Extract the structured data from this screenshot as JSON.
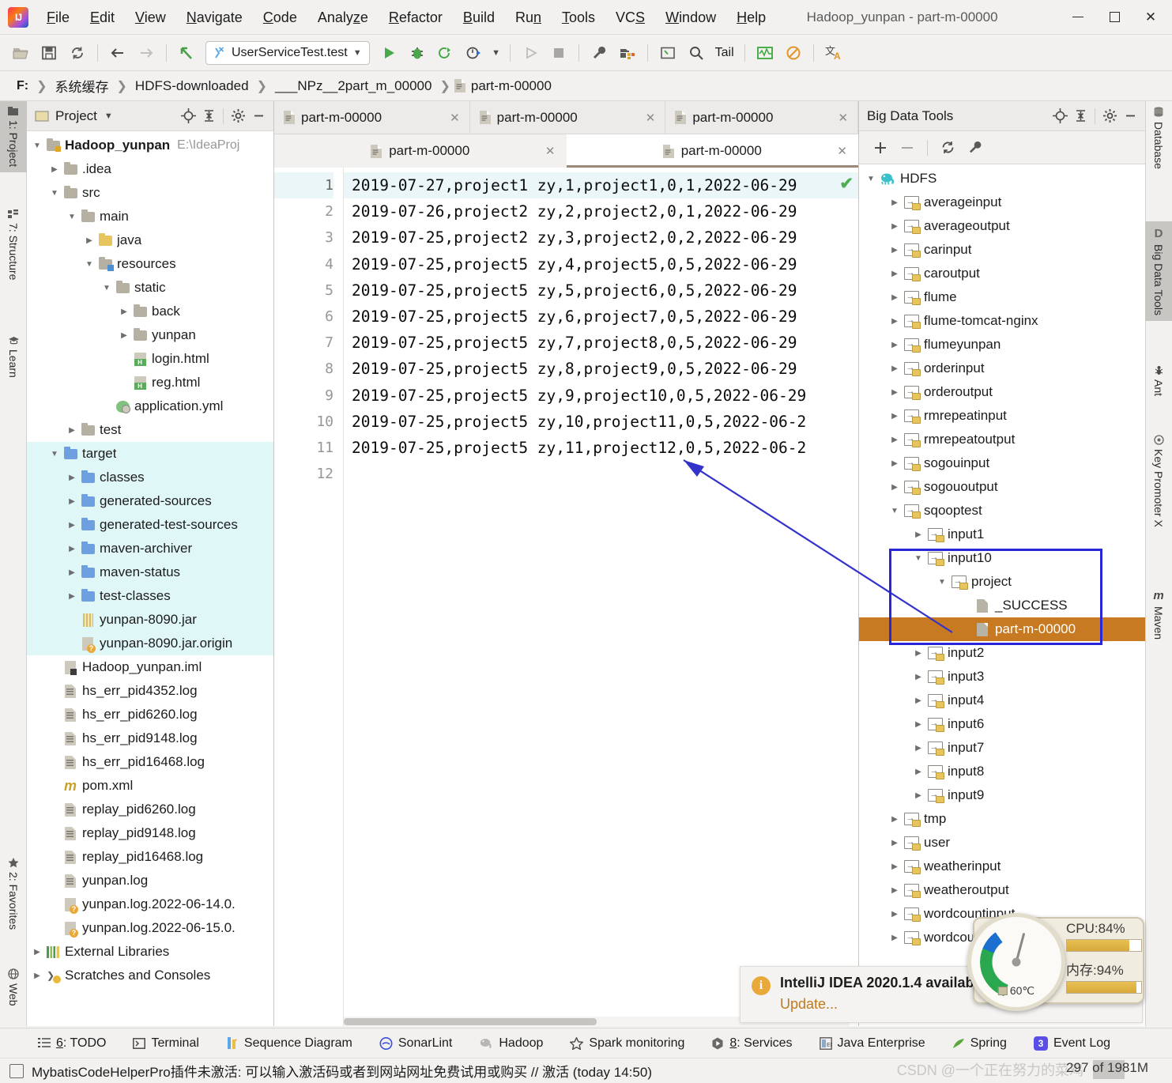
{
  "window": {
    "title": "Hadoop_yunpan - part-m-00000",
    "minimize": "–",
    "maximize": "□",
    "close": "✕"
  },
  "menu": [
    {
      "label": "File",
      "mnemonic": "F"
    },
    {
      "label": "Edit",
      "mnemonic": "E"
    },
    {
      "label": "View",
      "mnemonic": "V"
    },
    {
      "label": "Navigate",
      "mnemonic": "N"
    },
    {
      "label": "Code",
      "mnemonic": "C"
    },
    {
      "label": "Analyze",
      "mnemonic": "z"
    },
    {
      "label": "Refactor",
      "mnemonic": "R"
    },
    {
      "label": "Build",
      "mnemonic": "B"
    },
    {
      "label": "Run",
      "mnemonic": "n"
    },
    {
      "label": "Tools",
      "mnemonic": "T"
    },
    {
      "label": "VCS",
      "mnemonic": "S"
    },
    {
      "label": "Window",
      "mnemonic": "W"
    },
    {
      "label": "Help",
      "mnemonic": "H"
    }
  ],
  "toolbar": {
    "open_icon": "open-folder-icon",
    "save_icon": "save-icon",
    "sync_icon": "sync-icon",
    "back_icon": "back-arrow-icon",
    "forward_icon": "forward-arrow-icon",
    "undo_icon": "undo-icon",
    "run_config": "UserServiceTest.test",
    "run_icon": "run-icon",
    "debug_icon": "debug-icon",
    "run_coverage_icon": "run-with-coverage-icon",
    "profile_icon": "profile-icon",
    "stop_icon": "stop-icon",
    "settings_icon": "wrench-icon",
    "project_structure_icon": "project-structure-icon",
    "terminal_icon": "terminal-icon",
    "search_icon": "search-icon",
    "tail_label": "Tail",
    "monitor_icon": "monitor-icon",
    "block_icon": "block-icon",
    "translate_icon": "translate-icon"
  },
  "breadcrumb": {
    "drive": "F:",
    "items": [
      "系统缓存",
      "HDFS-downloaded",
      "___NPz__2part_m_00000",
      "part-m-00000"
    ]
  },
  "left_strip": [
    {
      "label": "1: Project",
      "icon": "project-icon",
      "active": true
    },
    {
      "label": "7: Structure",
      "icon": "structure-icon",
      "active": false
    },
    {
      "label": "Learn",
      "icon": "graduation-cap-icon",
      "active": false
    },
    {
      "label": "2: Favorites",
      "icon": "star-icon",
      "active": false
    },
    {
      "label": "Web",
      "icon": "globe-icon",
      "active": false
    }
  ],
  "right_strip": [
    {
      "label": "Database",
      "icon": "database-icon",
      "active": false
    },
    {
      "label": "Big Data Tools",
      "icon": "bigdata-icon",
      "active": true
    },
    {
      "label": "Ant",
      "icon": "ant-icon",
      "active": false
    },
    {
      "label": "Key Promoter X",
      "icon": "key-promoter-icon",
      "active": false
    },
    {
      "label": "Maven",
      "icon": "maven-icon",
      "active": false
    }
  ],
  "project_panel": {
    "title": "Project",
    "dropdown_icon": "chevron-down-icon",
    "locate_icon": "locate-target-icon",
    "collapse_icon": "collapse-all-icon",
    "settings_icon": "gear-icon",
    "hide_icon": "hide-icon",
    "tree": [
      {
        "label": "Hadoop_yunpan",
        "path": "E:\\IdeaProj",
        "indent": 0,
        "arrow": "down",
        "icon": "module-folder",
        "bold": true,
        "hl": false
      },
      {
        "label": ".idea",
        "indent": 1,
        "arrow": "right",
        "icon": "folder",
        "hl": false
      },
      {
        "label": "src",
        "indent": 1,
        "arrow": "down",
        "icon": "folder",
        "hl": false
      },
      {
        "label": "main",
        "indent": 2,
        "arrow": "down",
        "icon": "folder",
        "hl": false
      },
      {
        "label": "java",
        "indent": 3,
        "arrow": "right",
        "icon": "folder-yellow",
        "hl": false
      },
      {
        "label": "resources",
        "indent": 3,
        "arrow": "down",
        "icon": "folder-resources",
        "hl": false
      },
      {
        "label": "static",
        "indent": 4,
        "arrow": "down",
        "icon": "folder",
        "hl": false
      },
      {
        "label": "back",
        "indent": 5,
        "arrow": "right",
        "icon": "folder",
        "hl": false
      },
      {
        "label": "yunpan",
        "indent": 5,
        "arrow": "right",
        "icon": "folder",
        "hl": false
      },
      {
        "label": "login.html",
        "indent": 5,
        "arrow": "none",
        "icon": "html-file",
        "hl": false
      },
      {
        "label": "reg.html",
        "indent": 5,
        "arrow": "none",
        "icon": "html-file",
        "hl": false
      },
      {
        "label": "application.yml",
        "indent": 4,
        "arrow": "none",
        "icon": "yml-file",
        "hl": false
      },
      {
        "label": "test",
        "indent": 2,
        "arrow": "right",
        "icon": "folder",
        "hl": false
      },
      {
        "label": "target",
        "indent": 1,
        "arrow": "down",
        "icon": "folder-blue",
        "hl": true
      },
      {
        "label": "classes",
        "indent": 2,
        "arrow": "right",
        "icon": "folder-blue",
        "hl": true
      },
      {
        "label": "generated-sources",
        "indent": 2,
        "arrow": "right",
        "icon": "folder-blue",
        "hl": true
      },
      {
        "label": "generated-test-sources",
        "indent": 2,
        "arrow": "right",
        "icon": "folder-blue",
        "hl": true
      },
      {
        "label": "maven-archiver",
        "indent": 2,
        "arrow": "right",
        "icon": "folder-blue",
        "hl": true
      },
      {
        "label": "maven-status",
        "indent": 2,
        "arrow": "right",
        "icon": "folder-blue",
        "hl": true
      },
      {
        "label": "test-classes",
        "indent": 2,
        "arrow": "right",
        "icon": "folder-blue",
        "hl": true
      },
      {
        "label": "yunpan-8090.jar",
        "indent": 2,
        "arrow": "none",
        "icon": "jar-file",
        "hl": true
      },
      {
        "label": "yunpan-8090.jar.origin",
        "indent": 2,
        "arrow": "none",
        "icon": "unknown-file",
        "hl": true
      },
      {
        "label": "Hadoop_yunpan.iml",
        "indent": 1,
        "arrow": "none",
        "icon": "iml-file",
        "hl": false
      },
      {
        "label": "hs_err_pid4352.log",
        "indent": 1,
        "arrow": "none",
        "icon": "log-file",
        "hl": false
      },
      {
        "label": "hs_err_pid6260.log",
        "indent": 1,
        "arrow": "none",
        "icon": "log-file",
        "hl": false
      },
      {
        "label": "hs_err_pid9148.log",
        "indent": 1,
        "arrow": "none",
        "icon": "log-file",
        "hl": false
      },
      {
        "label": "hs_err_pid16468.log",
        "indent": 1,
        "arrow": "none",
        "icon": "log-file",
        "hl": false
      },
      {
        "label": "pom.xml",
        "indent": 1,
        "arrow": "none",
        "icon": "maven-file",
        "hl": false
      },
      {
        "label": "replay_pid6260.log",
        "indent": 1,
        "arrow": "none",
        "icon": "log-file",
        "hl": false
      },
      {
        "label": "replay_pid9148.log",
        "indent": 1,
        "arrow": "none",
        "icon": "log-file",
        "hl": false
      },
      {
        "label": "replay_pid16468.log",
        "indent": 1,
        "arrow": "none",
        "icon": "log-file",
        "hl": false
      },
      {
        "label": "yunpan.log",
        "indent": 1,
        "arrow": "none",
        "icon": "log-file",
        "hl": false
      },
      {
        "label": "yunpan.log.2022-06-14.0.",
        "indent": 1,
        "arrow": "none",
        "icon": "unknown-file",
        "hl": false
      },
      {
        "label": "yunpan.log.2022-06-15.0.",
        "indent": 1,
        "arrow": "none",
        "icon": "unknown-file",
        "hl": false
      },
      {
        "label": "External Libraries",
        "indent": 0,
        "arrow": "right",
        "icon": "libraries",
        "hl": false
      },
      {
        "label": "Scratches and Consoles",
        "indent": 0,
        "arrow": "right",
        "icon": "scratches",
        "hl": false
      }
    ]
  },
  "editor": {
    "tabs_row1": [
      {
        "label": "part-m-00000",
        "icon": "file-icon",
        "close": "✕"
      },
      {
        "label": "part-m-00000",
        "icon": "file-icon",
        "close": "✕"
      },
      {
        "label": "part-m-00000",
        "icon": "file-icon",
        "close": "✕"
      }
    ],
    "tabs_row2": [
      {
        "label": "part-m-00000",
        "icon": "file-icon",
        "close": "✕",
        "selected": false
      },
      {
        "label": "part-m-00000",
        "icon": "file-icon",
        "close": "✕",
        "selected": true
      }
    ],
    "inspection_mark": "✔",
    "lines": [
      {
        "n": "1",
        "text": "2019-07-27,project1 zy,1,project1,0,1,2022-06-29"
      },
      {
        "n": "2",
        "text": "2019-07-26,project2 zy,2,project2,0,1,2022-06-29"
      },
      {
        "n": "3",
        "text": "2019-07-25,project2 zy,3,project2,0,2,2022-06-29"
      },
      {
        "n": "4",
        "text": "2019-07-25,project5 zy,4,project5,0,5,2022-06-29"
      },
      {
        "n": "5",
        "text": "2019-07-25,project5 zy,5,project6,0,5,2022-06-29"
      },
      {
        "n": "6",
        "text": "2019-07-25,project5 zy,6,project7,0,5,2022-06-29"
      },
      {
        "n": "7",
        "text": "2019-07-25,project5 zy,7,project8,0,5,2022-06-29"
      },
      {
        "n": "8",
        "text": "2019-07-25,project5 zy,8,project9,0,5,2022-06-29"
      },
      {
        "n": "9",
        "text": "2019-07-25,project5 zy,9,project10,0,5,2022-06-29"
      },
      {
        "n": "10",
        "text": "2019-07-25,project5 zy,10,project11,0,5,2022-06-2"
      },
      {
        "n": "11",
        "text": "2019-07-25,project5 zy,11,project12,0,5,2022-06-2"
      },
      {
        "n": "12",
        "text": ""
      }
    ]
  },
  "bigdata": {
    "title": "Big Data Tools",
    "locate_icon": "locate-target-icon",
    "collapse_icon": "collapse-all-icon",
    "settings_icon": "gear-icon",
    "hide_icon": "hide-icon",
    "add_icon": "plus-icon",
    "remove_icon": "minus-icon",
    "refresh_icon": "refresh-icon",
    "config_icon": "wrench-icon",
    "tree": [
      {
        "label": "HDFS",
        "indent": 0,
        "arrow": "down",
        "icon": "elephant",
        "sel": false
      },
      {
        "label": "averageinput",
        "indent": 1,
        "arrow": "right",
        "icon": "hdfs-folder",
        "sel": false
      },
      {
        "label": "averageoutput",
        "indent": 1,
        "arrow": "right",
        "icon": "hdfs-folder",
        "sel": false
      },
      {
        "label": "carinput",
        "indent": 1,
        "arrow": "right",
        "icon": "hdfs-folder",
        "sel": false
      },
      {
        "label": "caroutput",
        "indent": 1,
        "arrow": "right",
        "icon": "hdfs-folder",
        "sel": false
      },
      {
        "label": "flume",
        "indent": 1,
        "arrow": "right",
        "icon": "hdfs-folder",
        "sel": false
      },
      {
        "label": "flume-tomcat-nginx",
        "indent": 1,
        "arrow": "right",
        "icon": "hdfs-folder",
        "sel": false
      },
      {
        "label": "flumeyunpan",
        "indent": 1,
        "arrow": "right",
        "icon": "hdfs-folder",
        "sel": false
      },
      {
        "label": "orderinput",
        "indent": 1,
        "arrow": "right",
        "icon": "hdfs-folder",
        "sel": false
      },
      {
        "label": "orderoutput",
        "indent": 1,
        "arrow": "right",
        "icon": "hdfs-folder",
        "sel": false
      },
      {
        "label": "rmrepeatinput",
        "indent": 1,
        "arrow": "right",
        "icon": "hdfs-folder",
        "sel": false
      },
      {
        "label": "rmrepeatoutput",
        "indent": 1,
        "arrow": "right",
        "icon": "hdfs-folder",
        "sel": false
      },
      {
        "label": "sogouinput",
        "indent": 1,
        "arrow": "right",
        "icon": "hdfs-folder",
        "sel": false
      },
      {
        "label": "sogououtput",
        "indent": 1,
        "arrow": "right",
        "icon": "hdfs-folder",
        "sel": false
      },
      {
        "label": "sqooptest",
        "indent": 1,
        "arrow": "down",
        "icon": "hdfs-folder",
        "sel": false
      },
      {
        "label": "input1",
        "indent": 2,
        "arrow": "right",
        "icon": "hdfs-folder",
        "sel": false
      },
      {
        "label": "input10",
        "indent": 2,
        "arrow": "down",
        "icon": "hdfs-folder",
        "sel": false
      },
      {
        "label": "project",
        "indent": 3,
        "arrow": "down",
        "icon": "hdfs-folder",
        "sel": false
      },
      {
        "label": "_SUCCESS",
        "indent": 4,
        "arrow": "none",
        "icon": "hdfs-file",
        "sel": false
      },
      {
        "label": "part-m-00000",
        "indent": 4,
        "arrow": "none",
        "icon": "hdfs-file",
        "sel": true
      },
      {
        "label": "input2",
        "indent": 2,
        "arrow": "right",
        "icon": "hdfs-folder",
        "sel": false
      },
      {
        "label": "input3",
        "indent": 2,
        "arrow": "right",
        "icon": "hdfs-folder",
        "sel": false
      },
      {
        "label": "input4",
        "indent": 2,
        "arrow": "right",
        "icon": "hdfs-folder",
        "sel": false
      },
      {
        "label": "input6",
        "indent": 2,
        "arrow": "right",
        "icon": "hdfs-folder",
        "sel": false
      },
      {
        "label": "input7",
        "indent": 2,
        "arrow": "right",
        "icon": "hdfs-folder",
        "sel": false
      },
      {
        "label": "input8",
        "indent": 2,
        "arrow": "right",
        "icon": "hdfs-folder",
        "sel": false
      },
      {
        "label": "input9",
        "indent": 2,
        "arrow": "right",
        "icon": "hdfs-folder",
        "sel": false
      },
      {
        "label": "tmp",
        "indent": 1,
        "arrow": "right",
        "icon": "hdfs-folder",
        "sel": false
      },
      {
        "label": "user",
        "indent": 1,
        "arrow": "right",
        "icon": "hdfs-folder",
        "sel": false
      },
      {
        "label": "weatherinput",
        "indent": 1,
        "arrow": "right",
        "icon": "hdfs-folder",
        "sel": false
      },
      {
        "label": "weatheroutput",
        "indent": 1,
        "arrow": "right",
        "icon": "hdfs-folder",
        "sel": false
      },
      {
        "label": "wordcountinput",
        "indent": 1,
        "arrow": "right",
        "icon": "hdfs-folder",
        "sel": false
      },
      {
        "label": "wordcountoutput",
        "indent": 1,
        "arrow": "right",
        "icon": "hdfs-folder",
        "sel": false
      }
    ]
  },
  "annotation": {
    "highlight_color": "#2727d8",
    "selection_color": "#c87a23",
    "arrow_color": "#3333cc"
  },
  "cpu_widget": {
    "cpu_label": "CPU:84%",
    "cpu_percent": 84,
    "mem_label": "内存:94%",
    "mem_percent": 94,
    "temperature": "60℃"
  },
  "notification": {
    "icon": "info-icon",
    "title": "IntelliJ IDEA 2020.1.4 available",
    "action": "Update..."
  },
  "bottom_bar": [
    {
      "label": "6: TODO",
      "icon": "todo-icon",
      "mnemonic": "6"
    },
    {
      "label": "Terminal",
      "icon": "terminal-icon"
    },
    {
      "label": "Sequence Diagram",
      "icon": "sequence-diagram-icon"
    },
    {
      "label": "SonarLint",
      "icon": "sonarlint-icon"
    },
    {
      "label": "Hadoop",
      "icon": "hadoop-elephant-icon"
    },
    {
      "label": "Spark monitoring",
      "icon": "star-icon"
    },
    {
      "label": "8: Services",
      "icon": "services-icon",
      "mnemonic": "8"
    },
    {
      "label": "Java Enterprise",
      "icon": "java-enterprise-icon"
    },
    {
      "label": "Spring",
      "icon": "spring-leaf-icon"
    },
    {
      "label": "Event Log",
      "icon": "event-log-icon",
      "badge": "3"
    }
  ],
  "status_bar": {
    "icon": "plugin-icon",
    "message": "MybatisCodeHelperPro插件未激活: 可以输入激活码或者到网站网址免费试用或购买 // 激活 (today 14:50)",
    "watermark": "CSDN @一个正在努力的菜鸡",
    "memory": "297 of 1981M"
  }
}
